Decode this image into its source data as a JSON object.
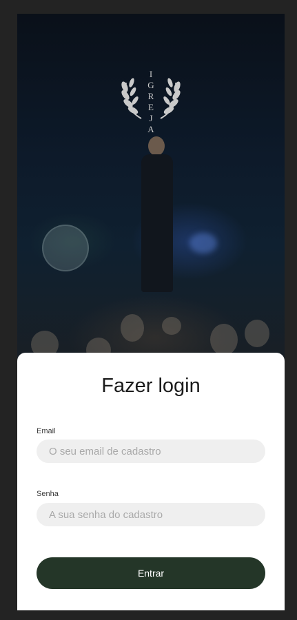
{
  "hero": {
    "logo_letters": [
      "I",
      "G",
      "R",
      "E",
      "J",
      "A"
    ],
    "logo_icon": "laurel-wreath-icon"
  },
  "login": {
    "title": "Fazer login",
    "email_label": "Email",
    "email_placeholder": "O seu email de cadastro",
    "password_label": "Senha",
    "password_placeholder": "A sua senha do cadastro",
    "submit_label": "Entrar"
  },
  "colors": {
    "background": "#232323",
    "button": "#243628",
    "input_bg": "#efefef",
    "sheet": "#ffffff"
  }
}
